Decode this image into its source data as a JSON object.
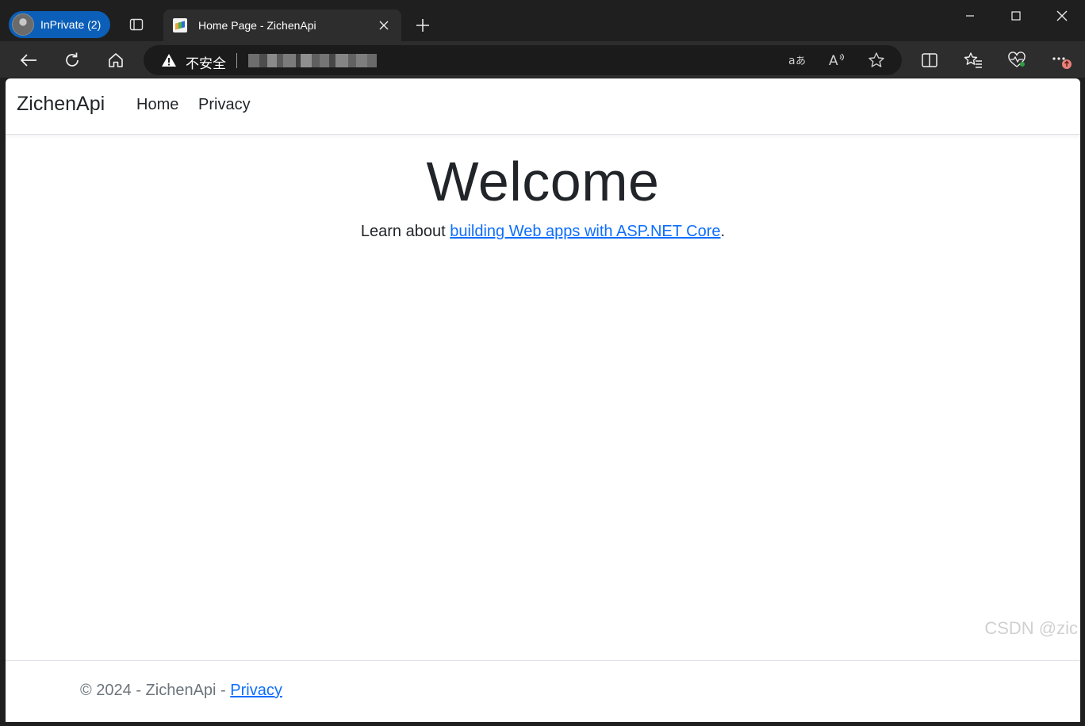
{
  "browser": {
    "profile_label": "InPrivate (2)",
    "tab_title": "Home Page - ZichenApi",
    "security_label": "不安全",
    "address_blurred": true,
    "read_aloud_glyph": "A̅",
    "accent_color": "#0c5fb8"
  },
  "site": {
    "brand": "ZichenApi",
    "nav": [
      {
        "label": "Home"
      },
      {
        "label": "Privacy"
      }
    ],
    "heading": "Welcome",
    "lead_prefix": "Learn about ",
    "lead_link": "building Web apps with ASP.NET Core",
    "lead_suffix": ".",
    "footer_prefix": "© 2024 - ZichenApi - ",
    "footer_link": "Privacy"
  },
  "watermark": "CSDN @zic"
}
